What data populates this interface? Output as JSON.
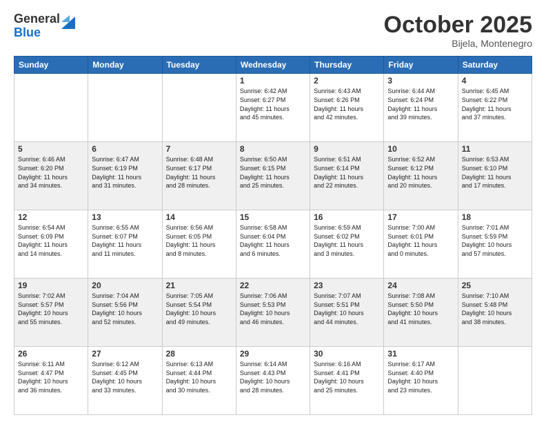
{
  "logo": {
    "general": "General",
    "blue": "Blue"
  },
  "title": "October 2025",
  "location": "Bijela, Montenegro",
  "days_of_week": [
    "Sunday",
    "Monday",
    "Tuesday",
    "Wednesday",
    "Thursday",
    "Friday",
    "Saturday"
  ],
  "weeks": [
    {
      "shaded": false,
      "days": [
        {
          "num": "",
          "info": ""
        },
        {
          "num": "",
          "info": ""
        },
        {
          "num": "",
          "info": ""
        },
        {
          "num": "1",
          "info": "Sunrise: 6:42 AM\nSunset: 6:27 PM\nDaylight: 11 hours\nand 45 minutes."
        },
        {
          "num": "2",
          "info": "Sunrise: 6:43 AM\nSunset: 6:26 PM\nDaylight: 11 hours\nand 42 minutes."
        },
        {
          "num": "3",
          "info": "Sunrise: 6:44 AM\nSunset: 6:24 PM\nDaylight: 11 hours\nand 39 minutes."
        },
        {
          "num": "4",
          "info": "Sunrise: 6:45 AM\nSunset: 6:22 PM\nDaylight: 11 hours\nand 37 minutes."
        }
      ]
    },
    {
      "shaded": true,
      "days": [
        {
          "num": "5",
          "info": "Sunrise: 6:46 AM\nSunset: 6:20 PM\nDaylight: 11 hours\nand 34 minutes."
        },
        {
          "num": "6",
          "info": "Sunrise: 6:47 AM\nSunset: 6:19 PM\nDaylight: 11 hours\nand 31 minutes."
        },
        {
          "num": "7",
          "info": "Sunrise: 6:48 AM\nSunset: 6:17 PM\nDaylight: 11 hours\nand 28 minutes."
        },
        {
          "num": "8",
          "info": "Sunrise: 6:50 AM\nSunset: 6:15 PM\nDaylight: 11 hours\nand 25 minutes."
        },
        {
          "num": "9",
          "info": "Sunrise: 6:51 AM\nSunset: 6:14 PM\nDaylight: 11 hours\nand 22 minutes."
        },
        {
          "num": "10",
          "info": "Sunrise: 6:52 AM\nSunset: 6:12 PM\nDaylight: 11 hours\nand 20 minutes."
        },
        {
          "num": "11",
          "info": "Sunrise: 6:53 AM\nSunset: 6:10 PM\nDaylight: 11 hours\nand 17 minutes."
        }
      ]
    },
    {
      "shaded": false,
      "days": [
        {
          "num": "12",
          "info": "Sunrise: 6:54 AM\nSunset: 6:09 PM\nDaylight: 11 hours\nand 14 minutes."
        },
        {
          "num": "13",
          "info": "Sunrise: 6:55 AM\nSunset: 6:07 PM\nDaylight: 11 hours\nand 11 minutes."
        },
        {
          "num": "14",
          "info": "Sunrise: 6:56 AM\nSunset: 6:05 PM\nDaylight: 11 hours\nand 8 minutes."
        },
        {
          "num": "15",
          "info": "Sunrise: 6:58 AM\nSunset: 6:04 PM\nDaylight: 11 hours\nand 6 minutes."
        },
        {
          "num": "16",
          "info": "Sunrise: 6:59 AM\nSunset: 6:02 PM\nDaylight: 11 hours\nand 3 minutes."
        },
        {
          "num": "17",
          "info": "Sunrise: 7:00 AM\nSunset: 6:01 PM\nDaylight: 11 hours\nand 0 minutes."
        },
        {
          "num": "18",
          "info": "Sunrise: 7:01 AM\nSunset: 5:59 PM\nDaylight: 10 hours\nand 57 minutes."
        }
      ]
    },
    {
      "shaded": true,
      "days": [
        {
          "num": "19",
          "info": "Sunrise: 7:02 AM\nSunset: 5:57 PM\nDaylight: 10 hours\nand 55 minutes."
        },
        {
          "num": "20",
          "info": "Sunrise: 7:04 AM\nSunset: 5:56 PM\nDaylight: 10 hours\nand 52 minutes."
        },
        {
          "num": "21",
          "info": "Sunrise: 7:05 AM\nSunset: 5:54 PM\nDaylight: 10 hours\nand 49 minutes."
        },
        {
          "num": "22",
          "info": "Sunrise: 7:06 AM\nSunset: 5:53 PM\nDaylight: 10 hours\nand 46 minutes."
        },
        {
          "num": "23",
          "info": "Sunrise: 7:07 AM\nSunset: 5:51 PM\nDaylight: 10 hours\nand 44 minutes."
        },
        {
          "num": "24",
          "info": "Sunrise: 7:08 AM\nSunset: 5:50 PM\nDaylight: 10 hours\nand 41 minutes."
        },
        {
          "num": "25",
          "info": "Sunrise: 7:10 AM\nSunset: 5:48 PM\nDaylight: 10 hours\nand 38 minutes."
        }
      ]
    },
    {
      "shaded": false,
      "days": [
        {
          "num": "26",
          "info": "Sunrise: 6:11 AM\nSunset: 4:47 PM\nDaylight: 10 hours\nand 36 minutes."
        },
        {
          "num": "27",
          "info": "Sunrise: 6:12 AM\nSunset: 4:45 PM\nDaylight: 10 hours\nand 33 minutes."
        },
        {
          "num": "28",
          "info": "Sunrise: 6:13 AM\nSunset: 4:44 PM\nDaylight: 10 hours\nand 30 minutes."
        },
        {
          "num": "29",
          "info": "Sunrise: 6:14 AM\nSunset: 4:43 PM\nDaylight: 10 hours\nand 28 minutes."
        },
        {
          "num": "30",
          "info": "Sunrise: 6:16 AM\nSunset: 4:41 PM\nDaylight: 10 hours\nand 25 minutes."
        },
        {
          "num": "31",
          "info": "Sunrise: 6:17 AM\nSunset: 4:40 PM\nDaylight: 10 hours\nand 23 minutes."
        },
        {
          "num": "",
          "info": ""
        }
      ]
    }
  ]
}
